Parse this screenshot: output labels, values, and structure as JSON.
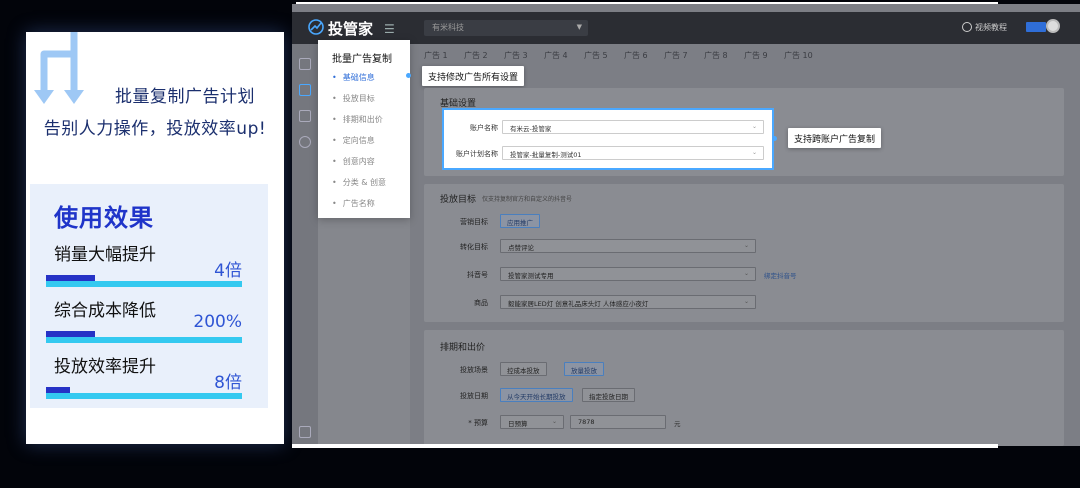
{
  "promo": {
    "headline_1": "批量复制广告计划",
    "headline_2": "告别人力操作，投放效率up!",
    "effects_title": "使用效果",
    "effects": [
      {
        "label": "销量大幅提升",
        "value": "4倍",
        "fill": 0.25
      },
      {
        "label": "综合成本降低",
        "value": "200%",
        "fill": 0.25
      },
      {
        "label": "投放效率提升",
        "value": "8倍",
        "fill": 0.12
      }
    ],
    "colors": {
      "title": "#1f34c9",
      "bar": "#34c9f0",
      "bar_fill": "#2632c6"
    }
  },
  "app": {
    "logo_text": "投管家",
    "org_select": "有米科技",
    "help_label": "视频教程",
    "stepnav": {
      "title": "批量广告复制",
      "steps": [
        "基础信息",
        "投放目标",
        "排期和出价",
        "定向信息",
        "创意内容",
        "分类 & 创意",
        "广告名称"
      ]
    },
    "tabs": [
      "广告 1",
      "广告 2",
      "广告 3",
      "广告 4",
      "广告 5",
      "广告 6",
      "广告 7",
      "广告 8",
      "广告 9",
      "广告 10"
    ],
    "callouts": {
      "modify_all": "支持修改广告所有设置",
      "cross_account": "支持跨账户广告复制"
    },
    "basic": {
      "title": "基础设置",
      "account_label": "账户名称",
      "account_value": "有米云-投管家",
      "plan_label": "账户计划名称",
      "plan_value": "投管家-批量复制-测试01"
    },
    "target": {
      "title": "投放目标",
      "hint": "仅支持复制官方和自定义的抖音号",
      "marketing_label": "营销目标",
      "marketing_value": "应用推广",
      "convert_label": "转化目标",
      "convert_value": "点赞评论",
      "douyin_label": "抖音号",
      "douyin_value": "投管家测试专用",
      "douyin_link": "绑定抖音号",
      "goods_label": "商品",
      "goods_value": "毅能家居LED灯 创意礼品床头灯 人体感应小夜灯"
    },
    "schedule": {
      "title": "排期和出价",
      "scene_label": "投放场景",
      "scene_opt1": "控成本投放",
      "scene_opt2": "放量投放",
      "date_label": "投放日期",
      "date_opt1": "从今天开始长期投放",
      "date_opt2": "指定投放日期",
      "budget_label": "* 预算",
      "budget_type": "日预算",
      "budget_value": "7878",
      "budget_unit": "元"
    }
  }
}
